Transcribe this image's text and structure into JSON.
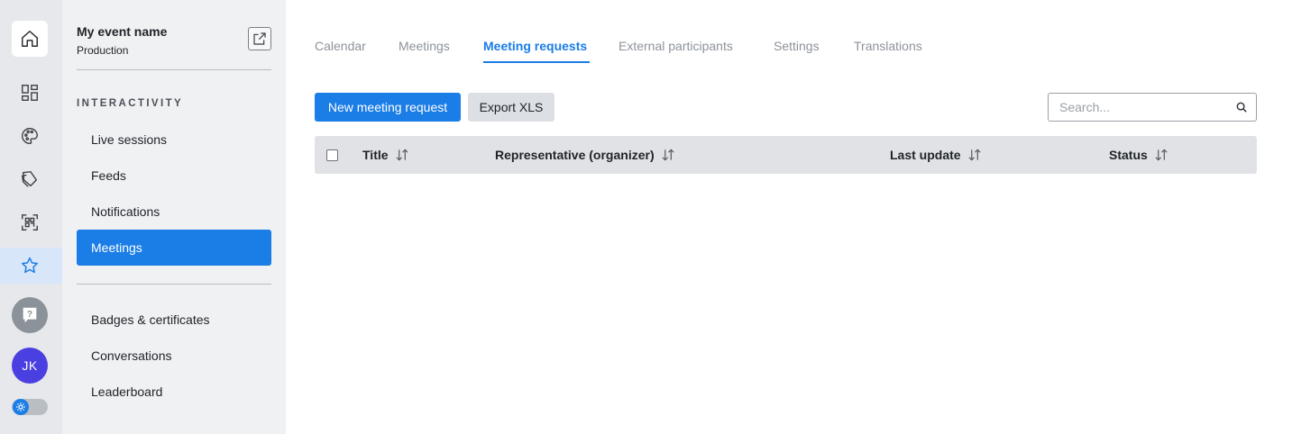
{
  "rail": {
    "avatar_initials": "JK",
    "icons": [
      "home-icon",
      "dashboard-icon",
      "palette-icon",
      "tags-icon",
      "qr-scan-icon",
      "star-icon",
      "help-icon",
      "theme-toggle"
    ],
    "active_color": "#1b7de6"
  },
  "sidebar": {
    "event_name": "My event name",
    "environment": "Production",
    "section_title": "INTERACTIVITY",
    "items": [
      {
        "label": "Live sessions"
      },
      {
        "label": "Feeds"
      },
      {
        "label": "Notifications"
      },
      {
        "label": "Meetings",
        "active": true
      }
    ],
    "items_secondary": [
      {
        "label": "Badges & certificates"
      },
      {
        "label": "Conversations"
      },
      {
        "label": "Leaderboard"
      }
    ]
  },
  "tabs": [
    {
      "label": "Calendar"
    },
    {
      "label": "Meetings"
    },
    {
      "label": "Meeting requests",
      "active": true
    },
    {
      "label": "External participants"
    },
    {
      "label": "Settings"
    },
    {
      "label": "Translations"
    }
  ],
  "toolbar": {
    "new_label": "New meeting request",
    "export_label": "Export XLS",
    "search_placeholder": "Search..."
  },
  "table": {
    "columns": [
      {
        "label": "Title"
      },
      {
        "label": "Representative (organizer)"
      },
      {
        "label": "Last update"
      },
      {
        "label": "Status"
      }
    ],
    "rows": []
  },
  "colors": {
    "accent": "#1b7de6",
    "sidebar_bg": "#f0f1f3",
    "rail_bg": "#e6e8eb",
    "avatar": "#4a3fe0"
  }
}
